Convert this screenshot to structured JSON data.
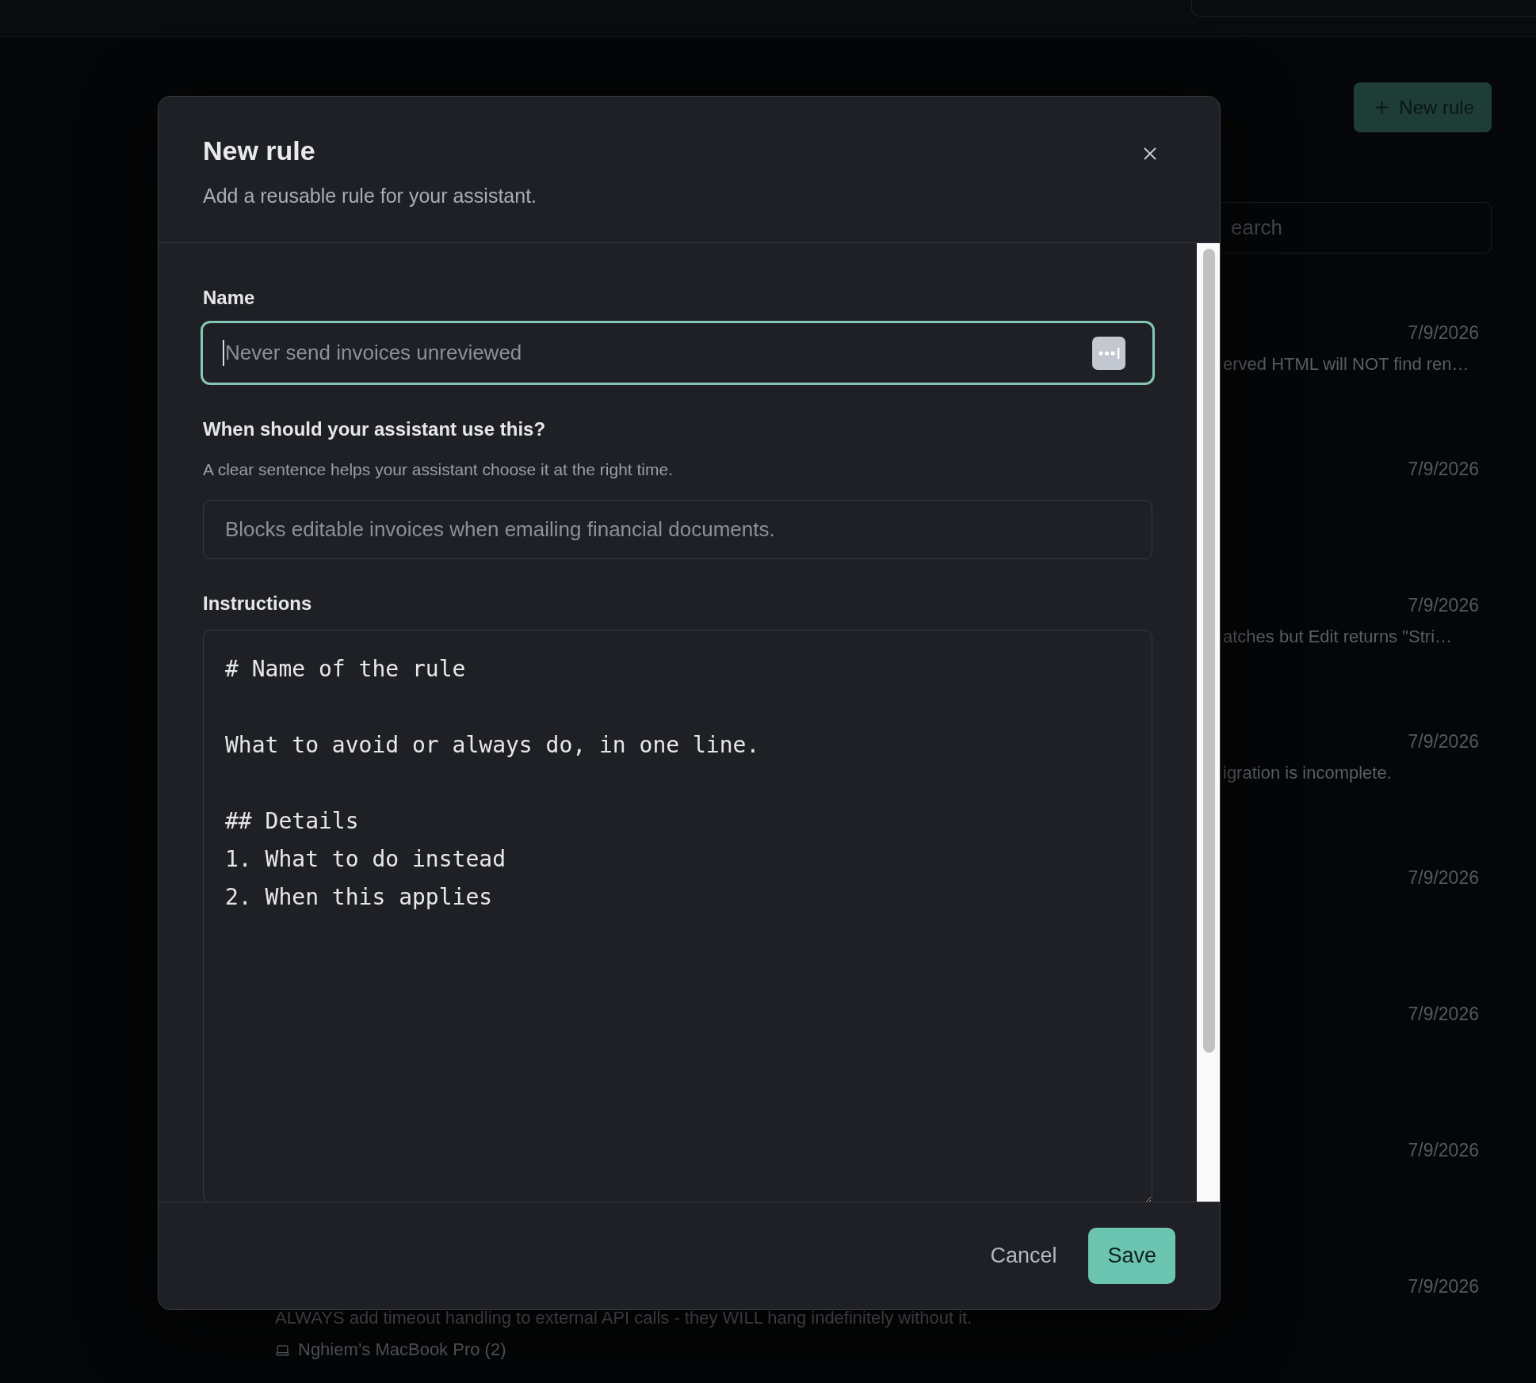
{
  "page": {
    "new_rule_button": "New rule",
    "search": {
      "placeholder": "earch"
    },
    "rules": [
      {
        "kind": "partial",
        "date": "7/9/2026",
        "description": "erved HTML will NOT find ren…"
      },
      {
        "kind": "partial",
        "date": "7/9/2026"
      },
      {
        "kind": "partial",
        "date": "7/9/2026",
        "description": "atches but Edit returns \"Stri…"
      },
      {
        "kind": "partial",
        "date": "7/9/2026",
        "description": "igration is incomplete."
      },
      {
        "kind": "partial",
        "date": "7/9/2026"
      },
      {
        "kind": "partial",
        "date": "7/9/2026"
      },
      {
        "kind": "partial",
        "date": "7/9/2026"
      },
      {
        "kind": "full",
        "date": "7/9/2026",
        "description": "ALWAYS add timeout handling to external API calls - they WILL hang indefinitely without it.",
        "device": "Nghiem’s MacBook Pro (2)"
      }
    ]
  },
  "dialog": {
    "title": "New rule",
    "subtitle": "Add a reusable rule for your assistant.",
    "fields": [
      {
        "kind": "input",
        "label": "Name",
        "placeholder": "Never send invoices unreviewed",
        "focused": true,
        "autofill": true
      },
      {
        "kind": "input",
        "label": "When should your assistant use this?",
        "hint": "A clear sentence helps your assistant choose it at the right time.",
        "placeholder": "Blocks editable invoices when emailing financial documents.",
        "focused": false
      },
      {
        "kind": "textarea",
        "label": "Instructions",
        "value": "# Name of the rule\n\nWhat to avoid or always do, in one line.\n\n## Details\n1. What to do instead\n2. When this applies"
      }
    ],
    "buttons": [
      {
        "kind": "secondary",
        "label": "Cancel"
      },
      {
        "kind": "primary",
        "label": "Save"
      }
    ]
  }
}
